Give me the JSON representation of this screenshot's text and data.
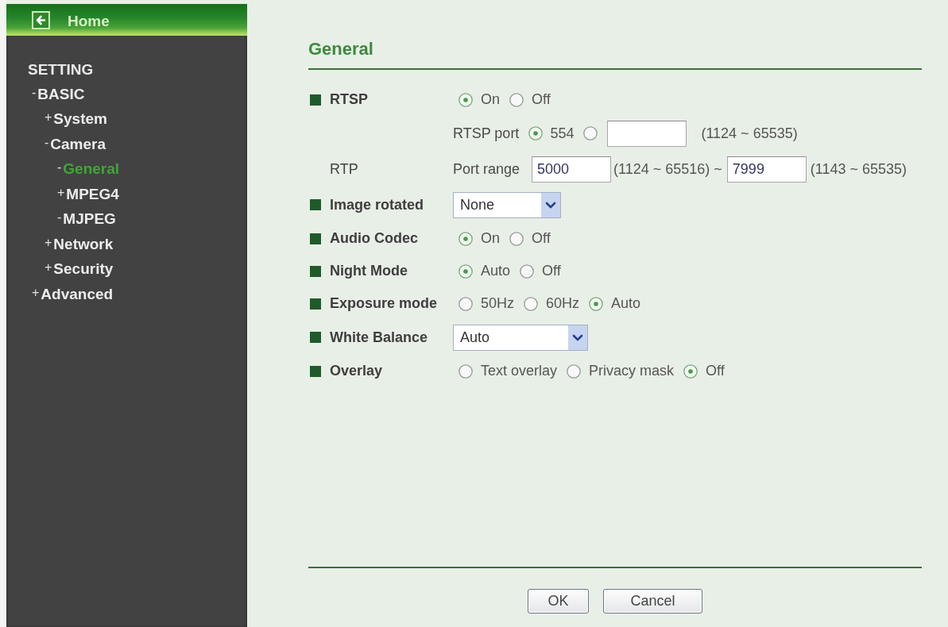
{
  "sidebar": {
    "home": {
      "label": "Home"
    },
    "heading": "SETTING",
    "tree": [
      {
        "marker": "-",
        "label": "BASIC",
        "selected": false,
        "children": [
          {
            "marker": "+",
            "label": "System",
            "selected": false
          },
          {
            "marker": "-",
            "label": "Camera",
            "selected": false,
            "children": [
              {
                "marker": "-",
                "label": "General",
                "selected": true
              },
              {
                "marker": "+",
                "label": "MPEG4",
                "selected": false
              },
              {
                "marker": "-",
                "label": "MJPEG",
                "selected": false
              }
            ]
          },
          {
            "marker": "+",
            "label": "Network",
            "selected": false
          },
          {
            "marker": "+",
            "label": "Security",
            "selected": false
          }
        ]
      },
      {
        "marker": "+",
        "label": "Advanced",
        "selected": false
      }
    ]
  },
  "form": {
    "title": "General",
    "rows": [
      {
        "kind": "radio",
        "label": "RTSP",
        "bullet": true,
        "options": [
          {
            "label": "On",
            "selected": true
          },
          {
            "label": "Off",
            "selected": false
          }
        ]
      },
      {
        "kind": "port",
        "bullet": false,
        "caption": "RTSP port",
        "options": [
          {
            "kind": "fixed",
            "label": "554",
            "selected": true
          },
          {
            "kind": "custom",
            "selected": false
          }
        ],
        "range": "(1124 ~ 65535)"
      },
      {
        "kind": "range",
        "label": "RTP",
        "bullet": false,
        "caption": "Port range",
        "from": "5000",
        "from_range": "(1124 ~ 65516)",
        "separator": "~",
        "to": "7999",
        "to_range": "(1143 ~ 65535)"
      },
      {
        "kind": "select",
        "label": "Image rotated",
        "bullet": true,
        "value": "None"
      },
      {
        "kind": "radio",
        "label": "Audio Codec",
        "bullet": true,
        "options": [
          {
            "label": "On",
            "selected": true
          },
          {
            "label": "Off",
            "selected": false
          }
        ]
      },
      {
        "kind": "radio",
        "label": "Night Mode",
        "bullet": true,
        "options": [
          {
            "label": "Auto",
            "selected": true
          },
          {
            "label": "Off",
            "selected": false
          }
        ]
      },
      {
        "kind": "radio",
        "label": "Exposure mode",
        "bullet": true,
        "options": [
          {
            "label": "50Hz",
            "selected": false
          },
          {
            "label": "60Hz",
            "selected": false
          },
          {
            "label": "Auto",
            "selected": true
          }
        ]
      },
      {
        "kind": "select",
        "label": "White Balance",
        "bullet": true,
        "value": "Auto"
      },
      {
        "kind": "radio",
        "label": "Overlay",
        "bullet": true,
        "options": [
          {
            "label": "Text overlay",
            "selected": false
          },
          {
            "label": "Privacy mask",
            "selected": false
          },
          {
            "label": "Off",
            "selected": true
          }
        ]
      }
    ]
  },
  "buttons": [
    {
      "label": "OK"
    },
    {
      "label": "Cancel"
    }
  ]
}
